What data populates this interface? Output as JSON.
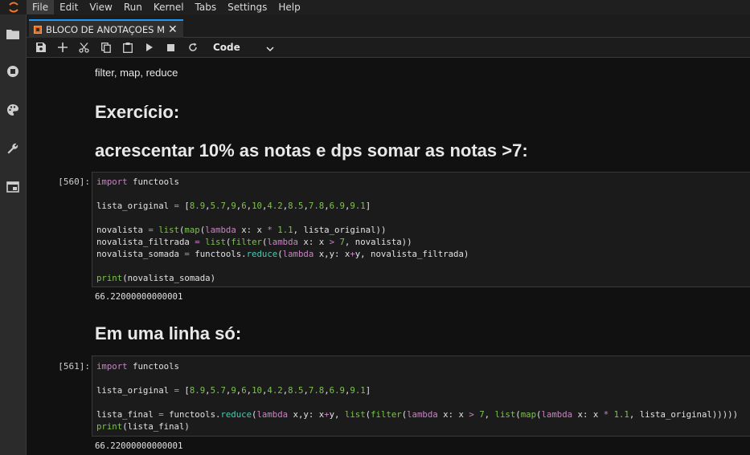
{
  "menu": [
    "File",
    "Edit",
    "View",
    "Run",
    "Kernel",
    "Tabs",
    "Settings",
    "Help"
  ],
  "tab": {
    "label": "BLOCO DE ANOTAÇOES Mo",
    "close": "✕"
  },
  "toolbar": {
    "cell_type": "Code"
  },
  "icons": {
    "logo": "jupyter-logo-icon",
    "sidebar": [
      "folder-icon",
      "running-stop-icon",
      "palette-icon",
      "wrench-icon",
      "tab-window-icon"
    ],
    "toolbar": [
      "save-icon",
      "add-cell-icon",
      "cut-icon",
      "copy-icon",
      "paste-icon",
      "run-icon",
      "stop-icon",
      "restart-icon"
    ]
  },
  "markdown": {
    "intro": "filter, map, reduce",
    "heading1": "Exercício:",
    "heading2": "acrescentar 10% as notas e dps somar as notas >7:",
    "heading3": "Em uma linha só:"
  },
  "cells": [
    {
      "prompt": "[560]:",
      "lines": [
        "import functools",
        "",
        "lista_original = [8.9,5.7,9,6,10,4.2,8.5,7.8,6.9,9.1]",
        "",
        "novalista = list(map(lambda x: x * 1.1, lista_original))",
        "novalista_filtrada = list(filter(lambda x: x > 7, novalista))",
        "novalista_somada = functools.reduce(lambda x,y: x+y, novalista_filtrada)",
        "",
        "print(novalista_somada)"
      ],
      "output": "66.22000000000001"
    },
    {
      "prompt": "[561]:",
      "lines": [
        "import functools",
        "",
        "lista_original = [8.9,5.7,9,6,10,4.2,8.5,7.8,6.9,9.1]",
        "",
        "lista_final = functools.reduce(lambda x,y: x+y, list(filter(lambda x: x > 7, list(map(lambda x: x * 1.1, lista_original)))))",
        "print(lista_final)"
      ],
      "output": "66.22000000000001"
    }
  ],
  "colors": {
    "accent": "#2196f3",
    "keyword": "#c586c0",
    "number": "#7ec24f",
    "builtin": "#4ec9b0"
  }
}
